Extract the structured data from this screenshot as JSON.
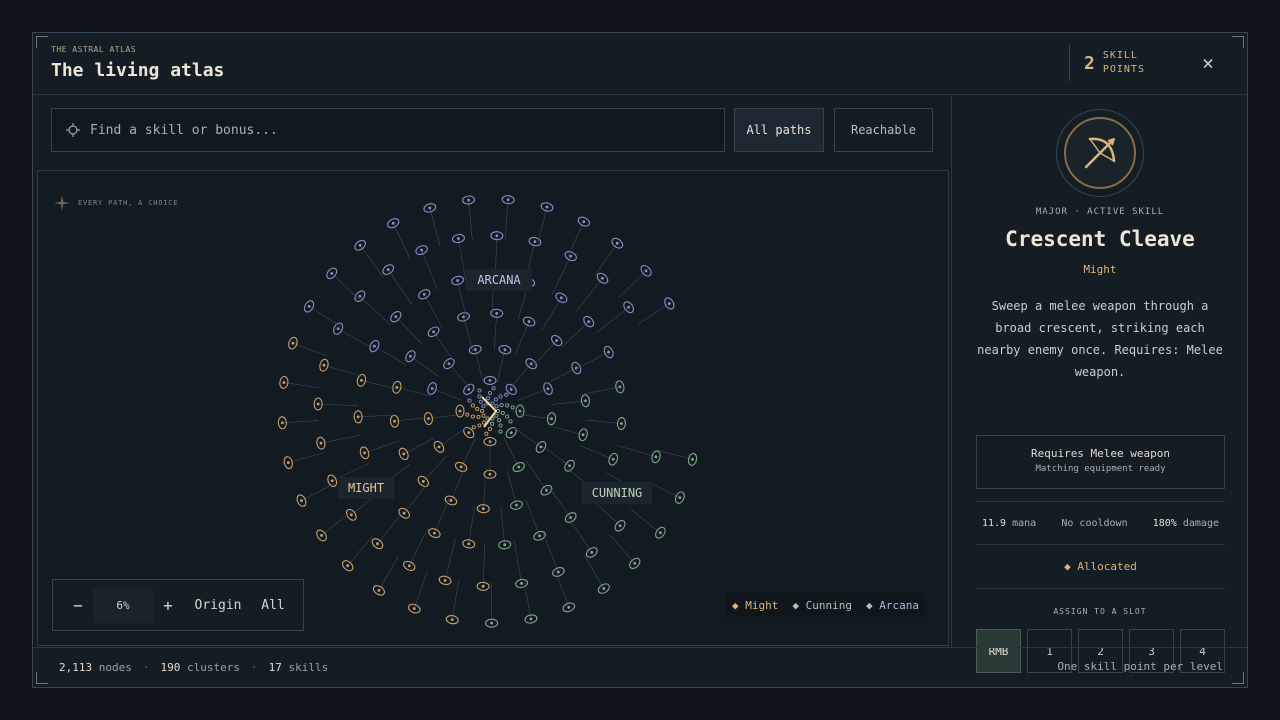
{
  "header": {
    "eyebrow": "THE ASTRAL ATLAS",
    "title": "The living atlas",
    "skill_points": "2",
    "skill_points_label": "SKILL POINTS",
    "close_icon": "×"
  },
  "toolbar": {
    "search_placeholder": "Find a skill or bonus...",
    "all_paths_label": "All paths",
    "reachable_label": "Reachable"
  },
  "map": {
    "motto": "EVERY PATH, A CHOICE",
    "labels": {
      "arcana": "ARCANA",
      "might": "MIGHT",
      "cunning": "CUNNING"
    },
    "zoom": {
      "minus": "−",
      "level": "6%",
      "plus": "+",
      "origin": "Origin",
      "all": "All"
    },
    "legend": [
      {
        "label": "Might",
        "color": "#d8b57e"
      },
      {
        "label": "Cunning",
        "color": "#8fb898"
      },
      {
        "label": "Arcana",
        "color": "#9a9cd0"
      }
    ],
    "path_colors": {
      "might": "#c9a06c",
      "cunning": "#7fa98a",
      "arcana": "#8c8ec4"
    }
  },
  "skill": {
    "icon": "crossbow-icon",
    "kind": "MAJOR · ACTIVE SKILL",
    "name": "Crescent Cleave",
    "path": "Might",
    "description": "Sweep a melee weapon through a broad crescent, striking each nearby enemy once. Requires: Melee weapon.",
    "requirement_title": "Requires Melee weapon",
    "requirement_sub": "Matching equipment ready",
    "stats": {
      "mana_value": "11.9",
      "mana_label": "mana",
      "cooldown": "No cooldown",
      "damage_value": "180%",
      "damage_label": "damage"
    },
    "allocated": "◆ Allocated",
    "assign_label": "ASSIGN TO A SLOT",
    "slots": [
      "RMB",
      "1",
      "2",
      "3",
      "4"
    ]
  },
  "footer": {
    "nodes_value": "2,113",
    "nodes_label": "nodes",
    "clusters_value": "190",
    "clusters_label": "clusters",
    "skills_value": "17",
    "skills_label": "skills",
    "hint": "One skill point per level"
  }
}
